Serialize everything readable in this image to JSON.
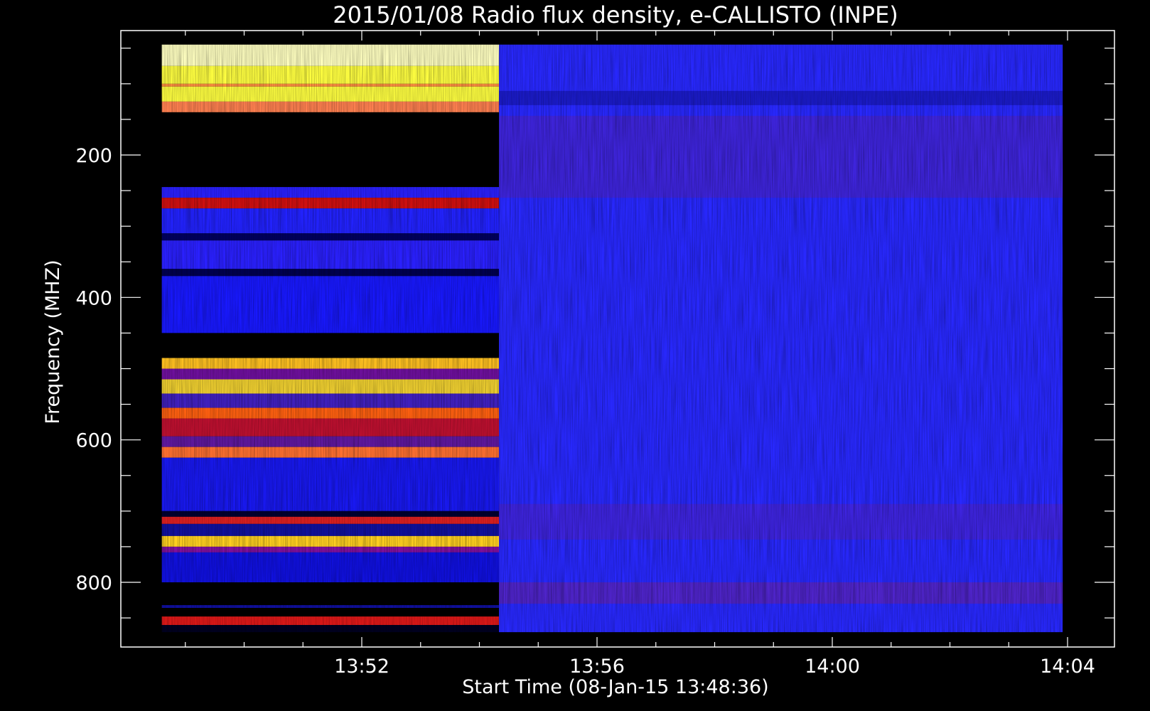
{
  "chart_data": {
    "type": "heatmap",
    "title": "2015/01/08  Radio flux density, e-CALLISTO (INPE)",
    "xlabel": "Start Time (08-Jan-15 13:48:36)",
    "ylabel": "Frequency (MHZ)",
    "x_range": [
      "13:48:36",
      "14:04:00"
    ],
    "xticks": [
      {
        "label": "13:52",
        "minutes_after_start": 3.4
      },
      {
        "label": "13:56",
        "minutes_after_start": 7.4
      },
      {
        "label": "14:00",
        "minutes_after_start": 11.4
      },
      {
        "label": "14:04",
        "minutes_after_start": 15.4
      }
    ],
    "ylim": [
      875,
      25
    ],
    "yticks": [
      200,
      400,
      600,
      800
    ],
    "data_time_range": [
      "13:48:36",
      "14:03:55"
    ],
    "data_freq_range": [
      45,
      870
    ],
    "colormap": [
      "#000000",
      "#1f1fff",
      "#ff1010",
      "#ff9040",
      "#ffff40",
      "#ffffc0"
    ],
    "segments": [
      {
        "name": "first",
        "time_range": [
          "13:48:36",
          "13:54:20"
        ],
        "bands": [
          {
            "from": 45,
            "to": 75,
            "color": "#ffffc0"
          },
          {
            "from": 75,
            "to": 100,
            "color": "#ffff40"
          },
          {
            "from": 100,
            "to": 104,
            "color": "#ff9040"
          },
          {
            "from": 104,
            "to": 125,
            "color": "#ffff40"
          },
          {
            "from": 125,
            "to": 140,
            "color": "#ff8050"
          },
          {
            "from": 140,
            "to": 245,
            "color": "#000000"
          },
          {
            "from": 245,
            "to": 260,
            "color": "#2a20ff"
          },
          {
            "from": 260,
            "to": 275,
            "color": "#d01010"
          },
          {
            "from": 275,
            "to": 310,
            "color": "#2222ff"
          },
          {
            "from": 310,
            "to": 320,
            "color": "#000060"
          },
          {
            "from": 320,
            "to": 360,
            "color": "#2a20ff"
          },
          {
            "from": 360,
            "to": 370,
            "color": "#000050"
          },
          {
            "from": 370,
            "to": 450,
            "color": "#1818ff"
          },
          {
            "from": 450,
            "to": 485,
            "color": "#000000"
          },
          {
            "from": 485,
            "to": 500,
            "color": "#ffc020"
          },
          {
            "from": 500,
            "to": 515,
            "color": "#7010a0"
          },
          {
            "from": 515,
            "to": 535,
            "color": "#f0d030"
          },
          {
            "from": 535,
            "to": 555,
            "color": "#4020c0"
          },
          {
            "from": 555,
            "to": 570,
            "color": "#ff6010"
          },
          {
            "from": 570,
            "to": 595,
            "color": "#c01030"
          },
          {
            "from": 595,
            "to": 610,
            "color": "#6018a0"
          },
          {
            "from": 610,
            "to": 625,
            "color": "#ff7030"
          },
          {
            "from": 625,
            "to": 700,
            "color": "#1818f0"
          },
          {
            "from": 700,
            "to": 708,
            "color": "#000030"
          },
          {
            "from": 708,
            "to": 718,
            "color": "#e02020"
          },
          {
            "from": 718,
            "to": 735,
            "color": "#1010a0"
          },
          {
            "from": 735,
            "to": 750,
            "color": "#ffd020"
          },
          {
            "from": 750,
            "to": 758,
            "color": "#8010a0"
          },
          {
            "from": 758,
            "to": 800,
            "color": "#1010e0"
          },
          {
            "from": 800,
            "to": 832,
            "color": "#000000"
          },
          {
            "from": 832,
            "to": 836,
            "color": "#1010a0"
          },
          {
            "from": 836,
            "to": 848,
            "color": "#000000"
          },
          {
            "from": 848,
            "to": 860,
            "color": "#e01818"
          },
          {
            "from": 860,
            "to": 870,
            "color": "#000020"
          }
        ]
      },
      {
        "name": "second",
        "time_range": [
          "13:54:20",
          "14:03:55"
        ],
        "base_color": "#2828ff",
        "bands": [
          {
            "from": 110,
            "to": 130,
            "color": "#1010a0"
          },
          {
            "from": 145,
            "to": 260,
            "color": "#5020c0"
          },
          {
            "from": 690,
            "to": 740,
            "color": "#5020c8"
          },
          {
            "from": 800,
            "to": 830,
            "color": "#7020a0"
          }
        ]
      }
    ]
  }
}
